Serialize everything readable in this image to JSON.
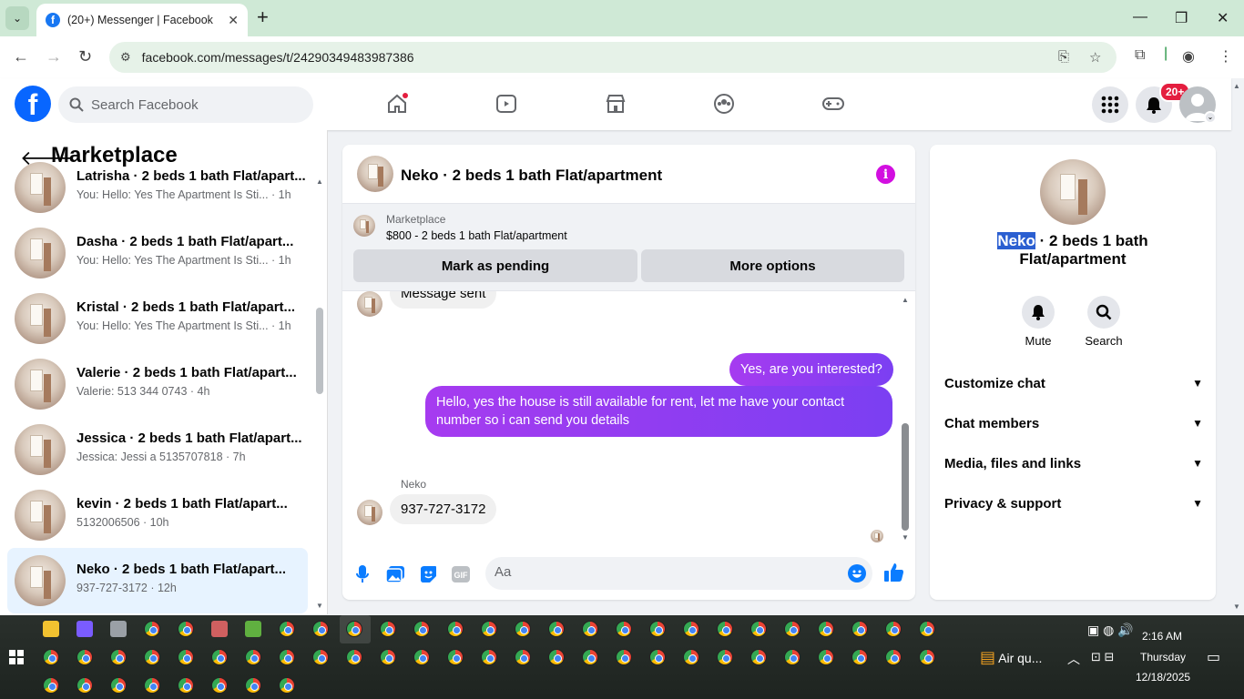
{
  "browser": {
    "tab_title": "(20+) Messenger | Facebook",
    "url": "facebook.com/messages/t/24290349483987386"
  },
  "fb": {
    "search_placeholder": "Search Facebook",
    "notification_badge": "20+"
  },
  "left_panel": {
    "title": "Marketplace",
    "conversations": [
      {
        "name": "Latrisha · 2 beds 1 bath Flat/apart...",
        "preview": "You: Hello: Yes The Apartment Is Sti... · 1h"
      },
      {
        "name": "Dasha · 2 beds 1 bath Flat/apart...",
        "preview": "You: Hello: Yes The Apartment Is Sti... · 1h"
      },
      {
        "name": "Kristal · 2 beds 1 bath Flat/apart...",
        "preview": "You: Hello: Yes The Apartment Is Sti... · 1h"
      },
      {
        "name": "Valerie · 2 beds 1 bath Flat/apart...",
        "preview": "Valerie: 513 344 0743 · 4h"
      },
      {
        "name": "Jessica · 2 beds 1 bath Flat/apart...",
        "preview": "Jessica: Jessi a 5135707818 · 7h"
      },
      {
        "name": "kevin · 2 beds 1 bath Flat/apart...",
        "preview": "5132006506 · 10h"
      },
      {
        "name": "Neko · 2 beds 1 bath Flat/apart...",
        "preview": "937-727-3172 · 12h"
      }
    ]
  },
  "chat": {
    "title": "Neko · 2 beds 1 bath Flat/apartment",
    "marketplace_label": "Marketplace",
    "listing": "$800 - 2 beds 1 bath Flat/apartment",
    "mark_pending": "Mark as pending",
    "more_options": "More options",
    "messages": {
      "msg_sent": "Message sent",
      "out1": "Yes, are you interested?",
      "out2": "Hello, yes the house is still available for rent, let me have your contact number so i can send you details",
      "sender": "Neko",
      "in1": "937-727-3172"
    },
    "composer_placeholder": "Aa"
  },
  "right_panel": {
    "name_highlight": "Neko",
    "name_rest": " · 2 beds 1 bath",
    "name_line2": "Flat/apartment",
    "mute": "Mute",
    "search": "Search",
    "rows": [
      "Customize chat",
      "Chat members",
      "Media, files and links",
      "Privacy & support"
    ]
  },
  "taskbar": {
    "weather": "Air qu...",
    "time": "2:16 AM",
    "day": "Thursday",
    "date": "12/18/2025"
  },
  "colors": {
    "fb_blue": "#0866ff",
    "accent_purple": "#a63bf0",
    "messenger_blue": "#0a7cff",
    "badge_red": "#e41e3f"
  }
}
